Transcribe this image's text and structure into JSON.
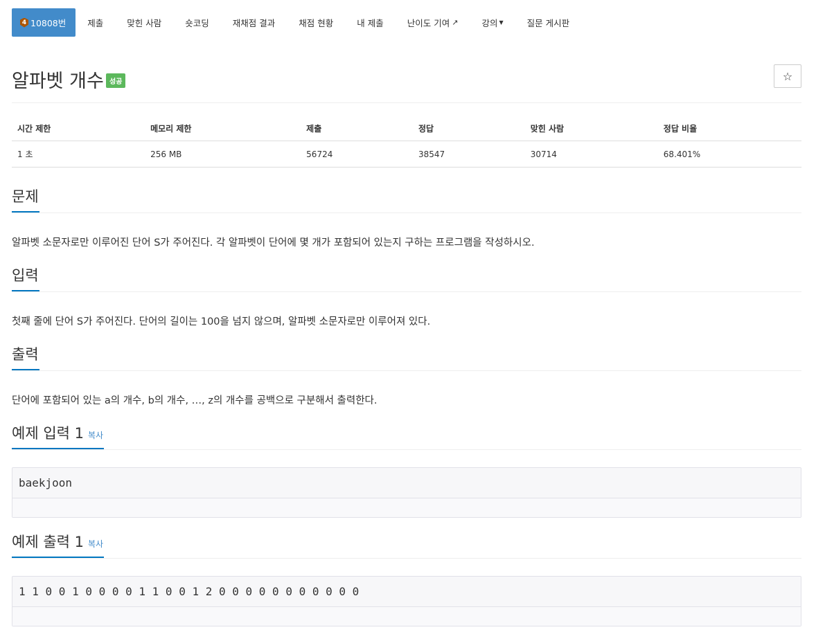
{
  "nav": {
    "problem_tab": {
      "tier_icon": "4",
      "label": "10808번"
    },
    "items": [
      "제출",
      "맞힌 사람",
      "숏코딩",
      "재채점 결과",
      "채점 현황",
      "내 제출",
      "난이도 기여",
      "강의",
      "질문 게시판"
    ]
  },
  "title": "알파벳 개수",
  "status_badge": "성공",
  "star_icon": "☆",
  "info": {
    "headers": [
      "시간 제한",
      "메모리 제한",
      "제출",
      "정답",
      "맞힌 사람",
      "정답 비율"
    ],
    "values": [
      "1 초",
      "256 MB",
      "56724",
      "38547",
      "30714",
      "68.401%"
    ]
  },
  "sections": {
    "problem": {
      "title": "문제",
      "body": "알파벳 소문자로만 이루어진 단어 S가 주어진다. 각 알파벳이 단어에 몇 개가 포함되어 있는지 구하는 프로그램을 작성하시오."
    },
    "input": {
      "title": "입력",
      "body": "첫째 줄에 단어 S가 주어진다. 단어의 길이는 100을 넘지 않으며, 알파벳 소문자로만 이루어져 있다."
    },
    "output": {
      "title": "출력",
      "body": "단어에 포함되어 있는 a의 개수, b의 개수, …, z의 개수를 공백으로 구분해서 출력한다."
    },
    "sample_input": {
      "title": "예제 입력 1",
      "copy": "복사",
      "value": "baekjoon"
    },
    "sample_output": {
      "title": "예제 출력 1",
      "copy": "복사",
      "value": "1 1 0 0 1 0 0 0 0 1 1 0 0 1 2 0 0 0 0 0 0 0 0 0 0 0"
    }
  },
  "colors": {
    "active_tab": "#428bca",
    "success": "#5cb85c",
    "accent": "#0076c0",
    "tier": "#ad5600"
  }
}
